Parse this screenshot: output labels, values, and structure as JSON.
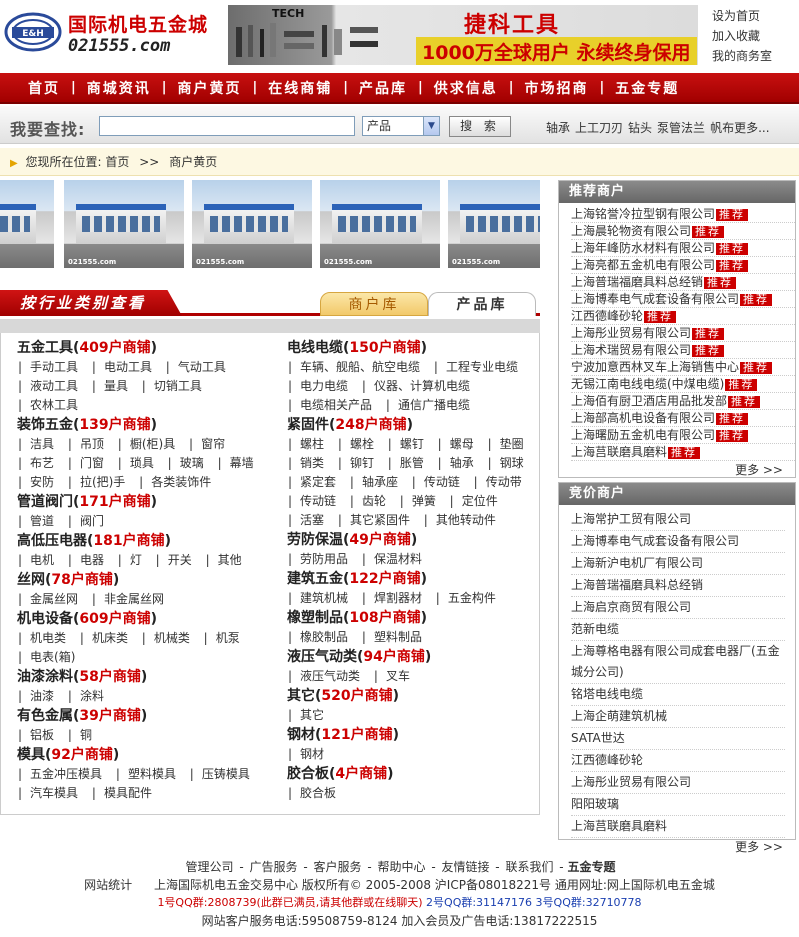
{
  "logo": {
    "name": "国际机电五金城",
    "url_text": "021555.com",
    "mark": "E&H"
  },
  "banner": {
    "brand": "TECH",
    "title": "捷科工具",
    "slogan": "1000万全球用户 永续终身保用"
  },
  "top_links": [
    "设为首页",
    "加入收藏",
    "我的商务室"
  ],
  "nav": [
    "首页",
    "商城资讯",
    "商户黄页",
    "在线商铺",
    "产品库",
    "供求信息",
    "市场招商",
    "五金专题"
  ],
  "search": {
    "label": "我要查找:",
    "value": "",
    "select": "产品",
    "button": "搜 索",
    "hot": [
      "轴承",
      "上工刀刃",
      "钻头",
      "泵管法兰",
      "帆布更多..."
    ]
  },
  "breadcrumb": {
    "prefix": "您现所在位置:",
    "home": "首页",
    "sep": ">>",
    "current": "商户黄页"
  },
  "photos": {
    "watermark": "021555.com"
  },
  "category": {
    "title": "按行业类别查看",
    "tab_merchant": "商户库",
    "tab_product": "产品库",
    "left": [
      {
        "name": "五金工具",
        "count": "409",
        "suffix": "户商铺",
        "items": [
          "手动工具",
          "电动工具",
          "气动工具",
          "液动工具",
          "量具",
          "切销工具",
          "农林工具"
        ]
      },
      {
        "name": "装饰五金",
        "count": "139",
        "suffix": "户商铺",
        "items": [
          "洁具",
          "吊顶",
          "橱(柜)具",
          "窗帘",
          "布艺",
          "门窗",
          "琐具",
          "玻璃",
          "幕墙",
          "安防",
          "拉(把)手",
          "各类装饰件"
        ]
      },
      {
        "name": "管道阀门",
        "count": "171",
        "suffix": "户商铺",
        "items": [
          "管道",
          "阀门"
        ]
      },
      {
        "name": "高低压电器",
        "count": "181",
        "suffix": "户商铺",
        "items": [
          "电机",
          "电器",
          "灯",
          "开关",
          "其他"
        ]
      },
      {
        "name": "丝网",
        "count": "78",
        "suffix": "户商铺",
        "items": [
          "金属丝网",
          "非金属丝网"
        ]
      },
      {
        "name": "机电设备",
        "count": "609",
        "suffix": "户商铺",
        "items": [
          "机电类",
          "机床类",
          "机械类",
          "机泵",
          "电表(箱)"
        ]
      },
      {
        "name": "油漆涂料",
        "count": "58",
        "suffix": "户商铺",
        "items": [
          "油漆",
          "涂料"
        ]
      },
      {
        "name": "有色金属",
        "count": "39",
        "suffix": "户商铺",
        "items": [
          "铝板",
          "铜"
        ]
      },
      {
        "name": "模具",
        "count": "92",
        "suffix": "户商铺",
        "items": [
          "五金冲压模具",
          "塑料模具",
          "压铸模具",
          "汽车模具",
          "模具配件"
        ]
      }
    ],
    "right": [
      {
        "name": "电线电缆",
        "count": "150",
        "suffix": "户商铺",
        "items": [
          "车辆、舰船、航空电缆",
          "工程专业电缆",
          "电力电缆",
          "仪器、计算机电缆",
          "电缆相关产品",
          "通信广播电缆"
        ]
      },
      {
        "name": "紧固件",
        "count": "248",
        "suffix": "户商铺",
        "items": [
          "螺柱",
          "螺栓",
          "螺钉",
          "螺母",
          "垫圈",
          "销类",
          "铆钉",
          "胀管",
          "轴承",
          "钢球",
          "紧定套",
          "轴承座",
          "传动链",
          "传动带",
          "传动链",
          "齿轮",
          "弹簧",
          "定位件",
          "活塞",
          "其它紧固件",
          "其他转动件"
        ]
      },
      {
        "name": "劳防保温",
        "count": "49",
        "suffix": "户商铺",
        "items": [
          "劳防用品",
          "保温材料"
        ]
      },
      {
        "name": "建筑五金",
        "count": "122",
        "suffix": "户商铺",
        "items": [
          "建筑机械",
          "焊割器材",
          "五金构件"
        ]
      },
      {
        "name": "橡塑制品",
        "count": "108",
        "suffix": "户商铺",
        "items": [
          "橡胶制品",
          "塑料制品"
        ]
      },
      {
        "name": "液压气动类",
        "count": "94",
        "suffix": "户商铺",
        "items": [
          "液压气动类",
          "叉车"
        ]
      },
      {
        "name": "其它",
        "count": "520",
        "suffix": "户商铺",
        "items": [
          "其它"
        ]
      },
      {
        "name": "钢材",
        "count": "121",
        "suffix": "户商铺",
        "items": [
          "钢材"
        ]
      },
      {
        "name": "胶合板",
        "count": "4",
        "suffix": "户商铺",
        "items": [
          "胶合板"
        ]
      }
    ]
  },
  "recommended": {
    "title": "推荐商户",
    "badge": "推荐",
    "more": "更多 >>",
    "items": [
      "上海铭誉冷拉型钢有限公司",
      "上海晨轮物资有限公司",
      "上海年峰防水材料有限公司",
      "上海亮都五金机电有限公司",
      "上海普瑞福磨具料总经销",
      "上海博奉电气成套设备有限公司",
      "江西德峰砂轮",
      "上海彤业贸易有限公司",
      "上海术瑞贸易有限公司",
      "宁波加意西林叉车上海销售中心",
      "无锡江南电线电缆(中煤电缆)",
      "上海佰有厨卫酒店用品批发部",
      "上海部高机电设备有限公司",
      "上海曙励五金机电有限公司",
      "上海莒联磨具磨料"
    ]
  },
  "bidding": {
    "title": "竞价商户",
    "more": "更多 >>",
    "items": [
      "上海常护工贸有限公司",
      "上海博奉电气成套设备有限公司",
      "上海新沪电机厂有限公司",
      "上海普瑞福磨具料总经销",
      "上海启京商贸有限公司",
      "范新电缆",
      "上海尊格电器有限公司成套电器厂(五金城分公司)",
      "铭塔电线电缆",
      "上海企萌建筑机械",
      "SATA世达",
      "江西德峰砂轮",
      "上海彤业贸易有限公司",
      "阳阳玻璃",
      "上海莒联磨具磨料"
    ]
  },
  "footer": {
    "links": [
      "管理公司",
      "广告服务",
      "客户服务",
      "帮助中心",
      "友情链接",
      "联系我们",
      "五金专题"
    ],
    "stats": "网站统计",
    "copyright": "上海国际机电五金交易中心 版权所有© 2005-2008 沪ICP备08018221号 通用网址:网上国际机电五金城",
    "qq1": "1号QQ群:2808739(此群已满员,请其他群或在线聊天)",
    "qq2": "2号QQ群:31147176",
    "qq3": "3号QQ群:32710778",
    "service": "网站客户服务电话:59508759-8124 加入会员及广告电话:13817222515"
  },
  "colors": {
    "brand_red": "#b00000",
    "count_red": "#cc0000"
  }
}
